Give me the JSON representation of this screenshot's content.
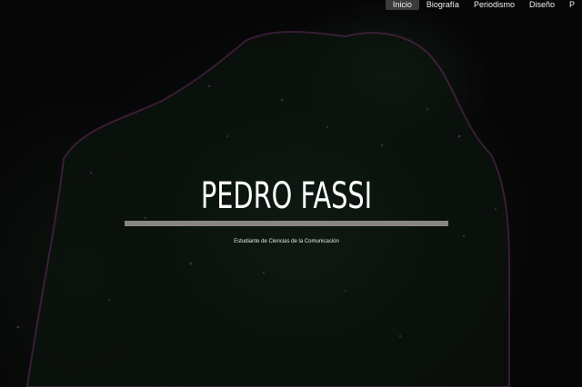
{
  "nav": {
    "items": [
      {
        "label": "Inicio",
        "active": true
      },
      {
        "label": "Biografía",
        "active": false
      },
      {
        "label": "Periodismo",
        "active": false
      },
      {
        "label": "Diseño",
        "active": false
      },
      {
        "label": "P",
        "active": false
      }
    ]
  },
  "hero": {
    "title": "PEDRO FASSI",
    "subtitle": "Estudiante de Ciencias de la Comunicación",
    "divider_color": "#8a8585"
  }
}
